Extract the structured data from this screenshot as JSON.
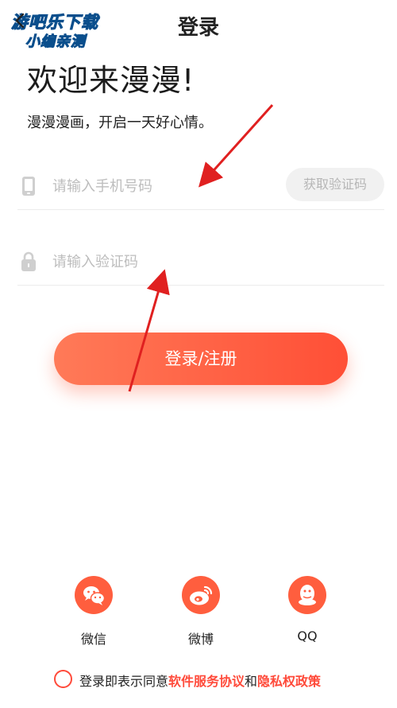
{
  "watermark": {
    "line1": "游吧乐下载",
    "line2": "小编亲测"
  },
  "header": {
    "title": "登录"
  },
  "welcome": {
    "headline": "欢迎来漫漫!",
    "subline": "漫漫漫画，开启一天好心情。"
  },
  "phone": {
    "placeholder": "请输入手机号码",
    "value": "",
    "get_code_label": "获取验证码"
  },
  "code": {
    "placeholder": "请输入验证码",
    "value": ""
  },
  "login_button": {
    "label": "登录/注册"
  },
  "social": [
    {
      "label": "微信",
      "icon": "wechat-icon"
    },
    {
      "label": "微博",
      "icon": "weibo-icon"
    },
    {
      "label": "QQ",
      "icon": "qq-icon"
    }
  ],
  "agreement": {
    "prefix": "登录即表示同意",
    "terms": "软件服务协议",
    "and": "和",
    "privacy": "隐私权政策"
  },
  "colors": {
    "accent": "#ff4f36",
    "accent_light": "#ff7a58",
    "watermark": "#18c4f0",
    "annotation_arrow": "#e02020"
  }
}
